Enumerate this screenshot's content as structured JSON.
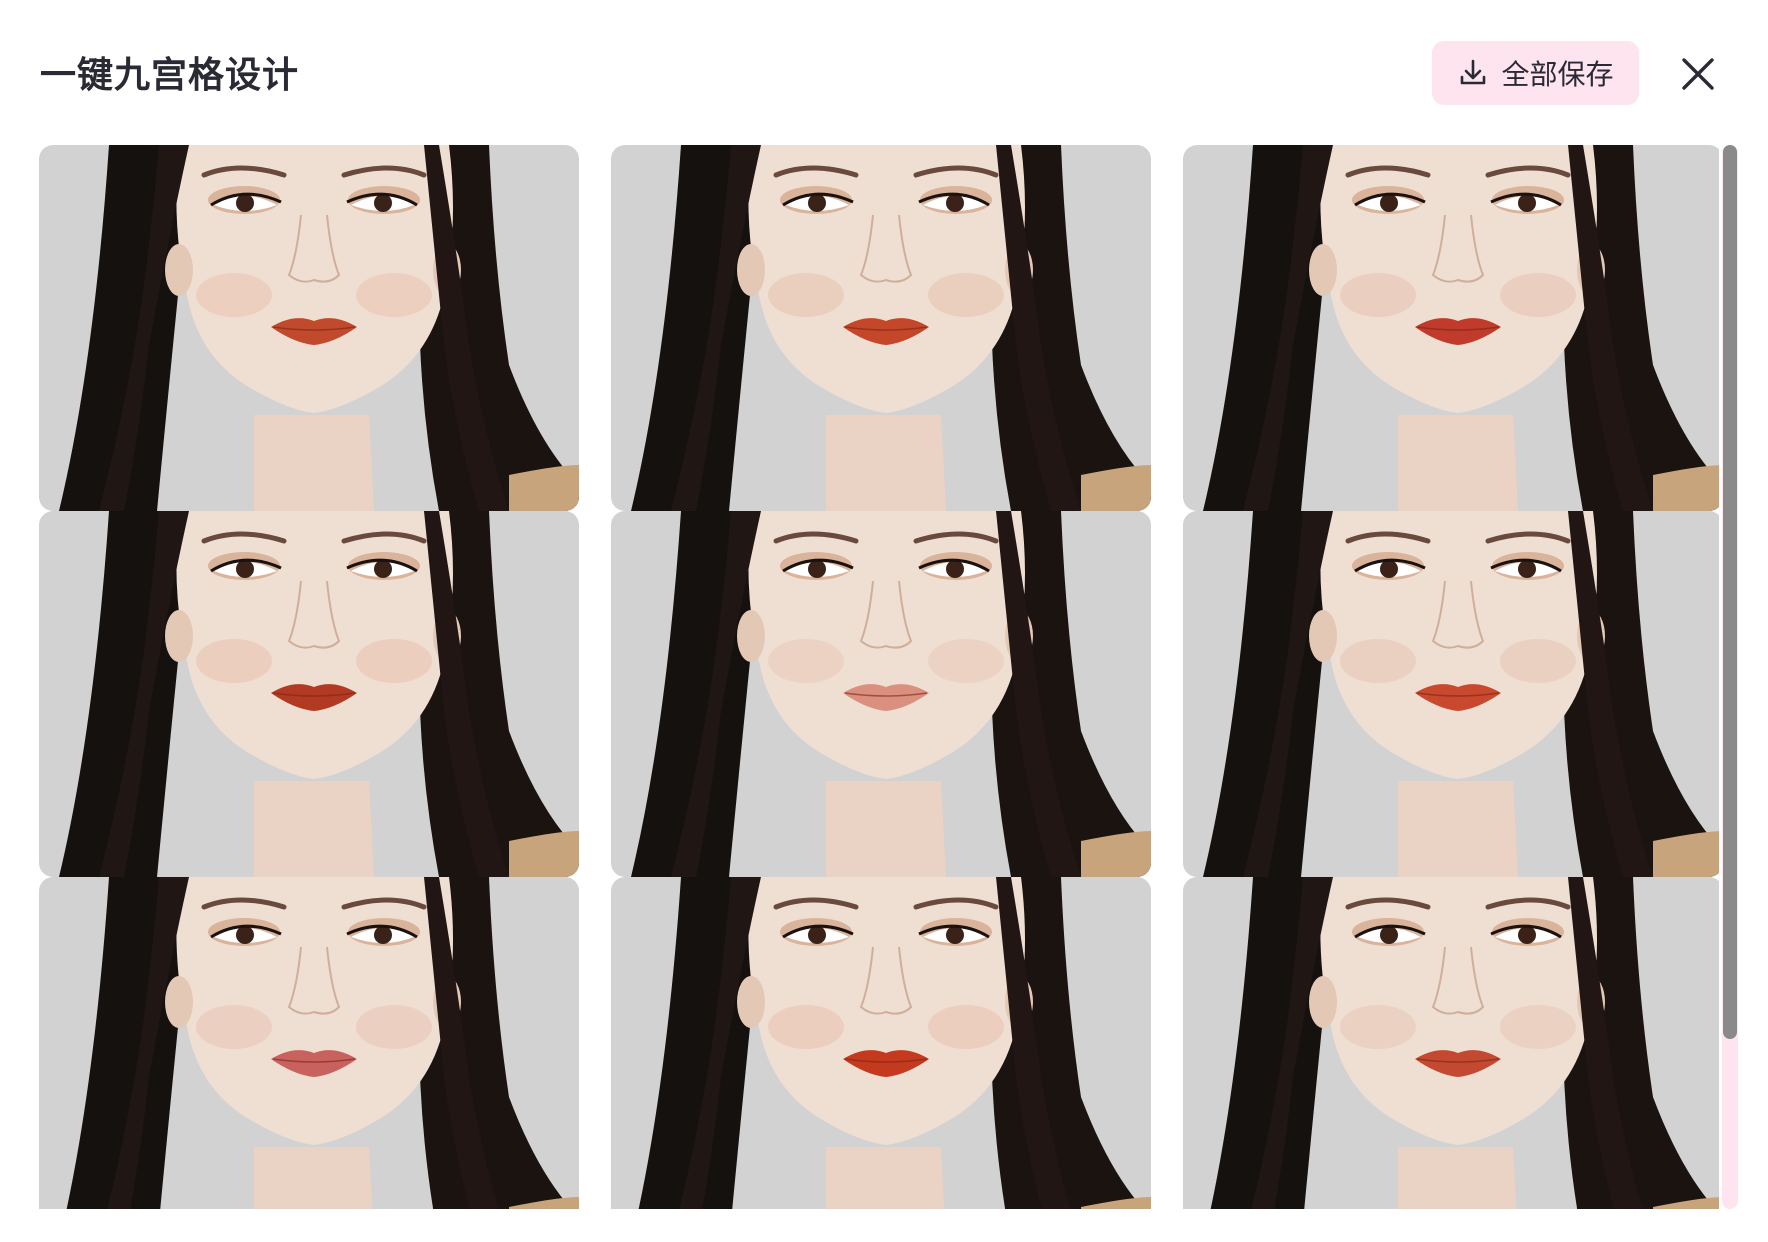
{
  "header": {
    "title": "一键九宫格设计",
    "save_all_label": "全部保存",
    "save_all_icon": "download-icon",
    "close_icon": "close-icon"
  },
  "colors": {
    "accent_pink": "#fde4ee",
    "title_text": "#2a2a35",
    "scrollbar_thumb": "#8a8a8a"
  },
  "grid": {
    "columns": 3,
    "rows": 3,
    "tiles": [
      {
        "lip_color": "#c24a2c",
        "blush": "#e7b29a"
      },
      {
        "lip_color": "#c4472a",
        "blush": "#e6b198"
      },
      {
        "lip_color": "#c13b2c",
        "blush": "#e2b3a0"
      },
      {
        "lip_color": "#b33a22",
        "blush": "#e4ae97"
      },
      {
        "lip_color": "#d9907f",
        "blush": "#e8bba6"
      },
      {
        "lip_color": "#c9492f",
        "blush": "#e3b49f"
      },
      {
        "lip_color": "#c8625f",
        "blush": "#e6b5a2"
      },
      {
        "lip_color": "#c43a1e",
        "blush": "#e5ae98"
      },
      {
        "lip_color": "#c34a30",
        "blush": "#e4b6a4"
      }
    ]
  },
  "scroll": {
    "position_fraction": 0.0,
    "visible_fraction": 0.84
  }
}
